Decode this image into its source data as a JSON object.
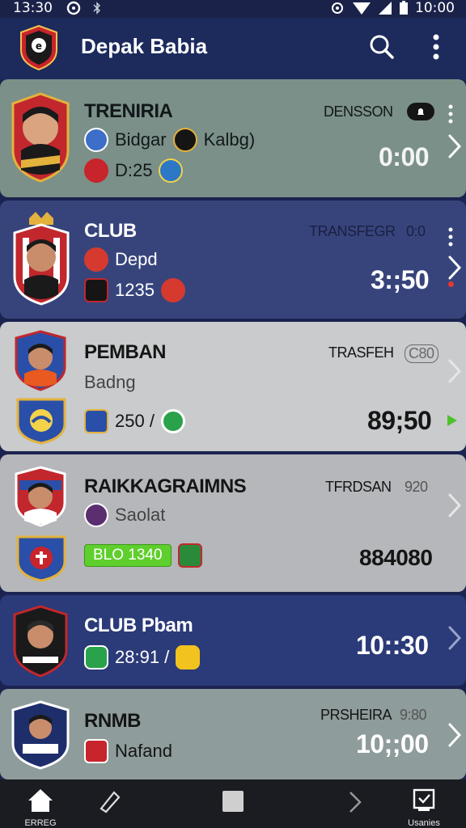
{
  "status_bar": {
    "time_left": "13:30",
    "time_right": "10:00"
  },
  "app_bar": {
    "title": "Depak Babia",
    "search_icon": "search-icon",
    "more_icon": "more-vert-icon"
  },
  "cards": [
    {
      "name": "TRENIRIA",
      "label_right": "DENSSON",
      "line1_a": "Bidgar",
      "line1_b": "Kalbg)",
      "line2": "D:25",
      "score": "0:00",
      "bell_icon": "bell-icon",
      "colors": {
        "bg": "#7b9088",
        "text": "#12181a"
      }
    },
    {
      "name": "CLUB",
      "label_right": "TRANSFEGR",
      "label_right_num": "0:0",
      "line1": "Depd",
      "line2": "1235",
      "score": "3:;50",
      "colors": {
        "bg": "#37447c",
        "text": "#ffffff"
      }
    },
    {
      "name": "PEMBAN",
      "label_right": "TRASFEH",
      "label_right_num": "C80",
      "line1": "Badng",
      "line2": "250 /",
      "score": "89;50",
      "colors": {
        "bg": "#c9cbcd",
        "text": "#151515"
      }
    },
    {
      "name": "RAIKKAGRAIMNS",
      "label_right": "TFRDSAN",
      "label_right_num": "920",
      "line1": "Saolat",
      "pill": "BLO 1340",
      "score": "884080",
      "colors": {
        "bg": "#b5b7ba",
        "text": "#151515",
        "pill": "#5ecf2c"
      }
    },
    {
      "name": "CLUB Pbam",
      "line1": "28:91 /",
      "score": "10::30",
      "colors": {
        "bg": "#2b3a78",
        "text": "#ffffff"
      }
    },
    {
      "name": "RNMB",
      "label_right": "PRSHEIRA",
      "label_right_num": "9:80",
      "line1": "Nafand",
      "score": "10;;00",
      "colors": {
        "bg": "#8e9c9b",
        "text": "#151515"
      }
    }
  ],
  "bottom_nav": {
    "home_label": "ERREG",
    "tasks_label": "Usanies",
    "home_icon": "home-icon",
    "edit_icon": "pencil-icon",
    "square_icon": "square-icon",
    "next_icon": "chevron-right-icon",
    "tasks_icon": "checkbox-icon"
  }
}
